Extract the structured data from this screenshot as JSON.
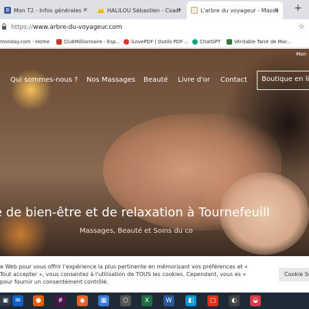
{
  "browser": {
    "tabs": [
      {
        "title": "Mon T2 - Infos générales",
        "icon_color": "#3b5998",
        "icon_text": "B"
      },
      {
        "title": "HALILOU Sébastien - Coaching",
        "icon_color": "#f2b705"
      },
      {
        "title": "L'arbre du voyageur - Massage",
        "icon_color": "#c8a46e",
        "active": true
      }
    ],
    "new_tab_label": "+",
    "close_label": "×",
    "url_proto": "https://",
    "url_host": "www.arbre-du-voyageur.com",
    "bookmarks": [
      {
        "label": "monday.com - Home",
        "icon_color": "#ff3d57"
      },
      {
        "label": "ClubMillionnaire - Esp...",
        "icon_color": "#c0392b"
      },
      {
        "label": "iLovePDF | Outils PDF ...",
        "icon_color": "#e5322d"
      },
      {
        "label": "ChatGPT",
        "icon_color": "#10a37f"
      },
      {
        "label": "Véritable Tarot de Mar...",
        "icon_color": "#2e7d32"
      }
    ]
  },
  "site": {
    "top_link": "Mon",
    "nav": [
      "Qui sommes-nous ?",
      "Nos Massages",
      "Beauté",
      "Livre d'or",
      "Contact"
    ],
    "shop_button": "Boutique en li",
    "hero_title": "e de bien-être et de relaxation à Tournefeuill",
    "hero_subtitle": "Massages, Beauté et Soins du co"
  },
  "cookie": {
    "text": "e Web pour vous offrir l'expérience la plus pertinente en mémorisant vos préférences et « Tout accepter », vous consentez à l'utilisation de TOUS les cookies. Cependant, vous es » pour fournir un consentement contrôlé.",
    "settings_button": "Cookie Se"
  },
  "taskbar": {
    "icons": [
      {
        "name": "task-view-icon",
        "color": "#2d3b4a",
        "glyph": "▣"
      },
      {
        "name": "mail-icon",
        "color": "#0a64c8",
        "glyph": "✉"
      },
      {
        "name": "firefox-icon",
        "color": "#e66000",
        "glyph": "●"
      },
      {
        "name": "slack-icon",
        "color": "#4a154b",
        "glyph": "#"
      },
      {
        "name": "app-orange-icon",
        "color": "#e8602c",
        "glyph": "◉"
      },
      {
        "name": "store-icon",
        "color": "#3a7bd5",
        "glyph": "▦"
      },
      {
        "name": "cube-icon",
        "color": "#555555",
        "glyph": "⬡"
      },
      {
        "name": "excel-icon",
        "color": "#1d6f42",
        "glyph": "X"
      },
      {
        "name": "word-icon",
        "color": "#2b579a",
        "glyph": "W"
      },
      {
        "name": "app-blue-icon",
        "color": "#0096d6",
        "glyph": "◧"
      },
      {
        "name": "app-red-icon",
        "color": "#e0301e",
        "glyph": "▢"
      },
      {
        "name": "browser-icon",
        "color": "#444444",
        "glyph": "◐"
      },
      {
        "name": "app-circle-icon",
        "color": "#d73a49",
        "glyph": "◒"
      }
    ]
  }
}
